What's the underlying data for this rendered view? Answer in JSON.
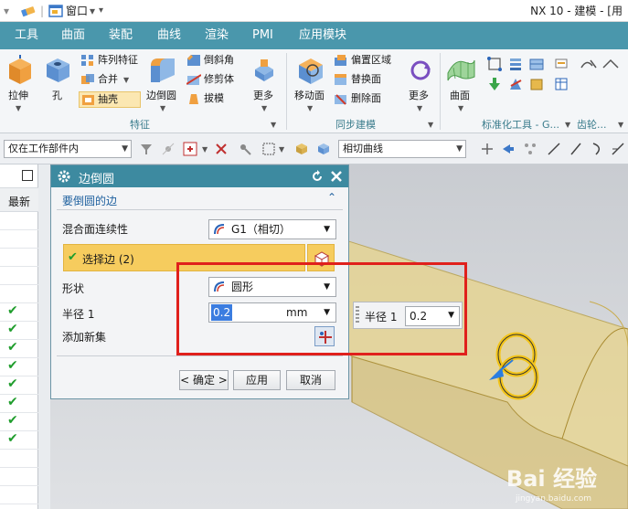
{
  "titlebar": {
    "window_menu": "窗口",
    "window_caret": "▾",
    "app_title": "NX 10 - 建模 - [用"
  },
  "tabs": [
    "工具",
    "曲面",
    "装配",
    "曲线",
    "渲染",
    "PMI",
    "应用模块"
  ],
  "ribbon": {
    "feature": {
      "extrude": "拉伸",
      "hole": "孔",
      "pattern_feature": "阵列特征",
      "unite": "合并",
      "shell": "抽壳",
      "edge_blend": "边倒圆",
      "chamfer": "倒斜角",
      "trim_body": "修剪体",
      "draft": "拔模",
      "more": "更多",
      "group_label": "特征"
    },
    "sync": {
      "move_face": "移动面",
      "offset_region": "偏置区域",
      "replace_face": "替换面",
      "delete_face": "删除面",
      "more": "更多",
      "group_label": "同步建模"
    },
    "surface": {
      "surface": "曲面",
      "group_label": "标准化工具 - G...",
      "gear_label": "齿轮..."
    }
  },
  "toolbar2": {
    "selection_filter": "仅在工作部件内",
    "curve_rule": "相切曲线"
  },
  "left_panel": {
    "header": "最新",
    "checks": [
      "✔",
      "✔",
      "✔",
      "✔",
      "✔",
      "✔",
      "✔",
      "✔"
    ]
  },
  "dialog": {
    "title": "边倒圆",
    "section_title": "要倒圆的边",
    "continuity_label": "混合面连续性",
    "continuity_value": "G1（相切）",
    "select_edge_label": "选择边 (2)",
    "shape_label": "形状",
    "shape_value": "圆形",
    "radius_label": "半径 1",
    "radius_value": "0.2",
    "radius_unit": "mm",
    "add_new_set_label": "添加新集",
    "ok_button": "< 确定 >",
    "apply_button": "应用",
    "cancel_button": "取消"
  },
  "float_field": {
    "label": "半径 1",
    "value": "0.2"
  },
  "watermark": {
    "brand": "Bai 经验",
    "sub": "jingyan.baidu.com"
  },
  "colors": {
    "ribbon_tab_bg": "#4a97ac",
    "dialog_title_bg": "#3d8aa0",
    "selected_row_bg": "#f6cc5e",
    "highlight_box": "#e0201c",
    "check_green": "#1f9d2c",
    "part_yellow": "#e8d48a"
  }
}
